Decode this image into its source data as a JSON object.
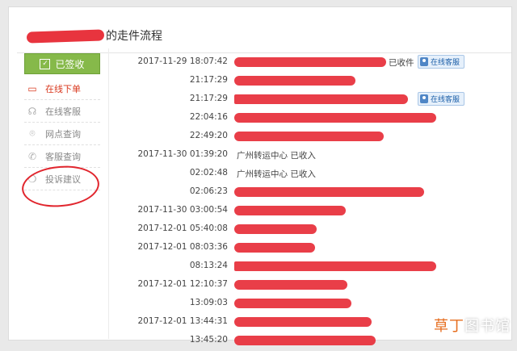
{
  "page": {
    "title_suffix": "的走件流程",
    "watermark_a": "草丁",
    "watermark_b": "图书馆"
  },
  "sidebar": {
    "signed_label": "已签收",
    "items": [
      {
        "label": "在线下单",
        "icon": "laptop-icon"
      },
      {
        "label": "在线客服",
        "icon": "headset-icon"
      },
      {
        "label": "网点查询",
        "icon": "location-pin-icon"
      },
      {
        "label": "客服查询",
        "icon": "phone-icon"
      },
      {
        "label": "投诉建议",
        "icon": "chat-bubble-icon"
      }
    ]
  },
  "colors": {
    "accent_green": "#86b94a",
    "redaction": "#e8343e",
    "active_red": "#d9381e"
  },
  "timeline": [
    {
      "time": "2017-11-29 18:07:42",
      "text": "已收件",
      "service": "在线客服"
    },
    {
      "time": "21:17:29",
      "text": ""
    },
    {
      "time": "21:17:29",
      "text": "",
      "service": "在线客服"
    },
    {
      "time": "22:04:16",
      "text": ""
    },
    {
      "time": "22:49:20",
      "text": ""
    },
    {
      "time": "2017-11-30 01:39:20",
      "text": "广州转运中心 已收入"
    },
    {
      "time": "02:02:48",
      "text": "广州转运中心 已收入"
    },
    {
      "time": "02:06:23",
      "text": ""
    },
    {
      "time": "2017-11-30 03:00:54",
      "text": ""
    },
    {
      "time": "2017-12-01 05:40:08",
      "text": ""
    },
    {
      "time": "2017-12-01 08:03:36",
      "text": ""
    },
    {
      "time": "08:13:24",
      "text": ""
    },
    {
      "time": "2017-12-01 12:10:37",
      "text": ""
    },
    {
      "time": "13:09:03",
      "text": ""
    },
    {
      "time": "2017-12-01 13:44:31",
      "text": ""
    },
    {
      "time": "13:45:20",
      "text": ""
    }
  ]
}
